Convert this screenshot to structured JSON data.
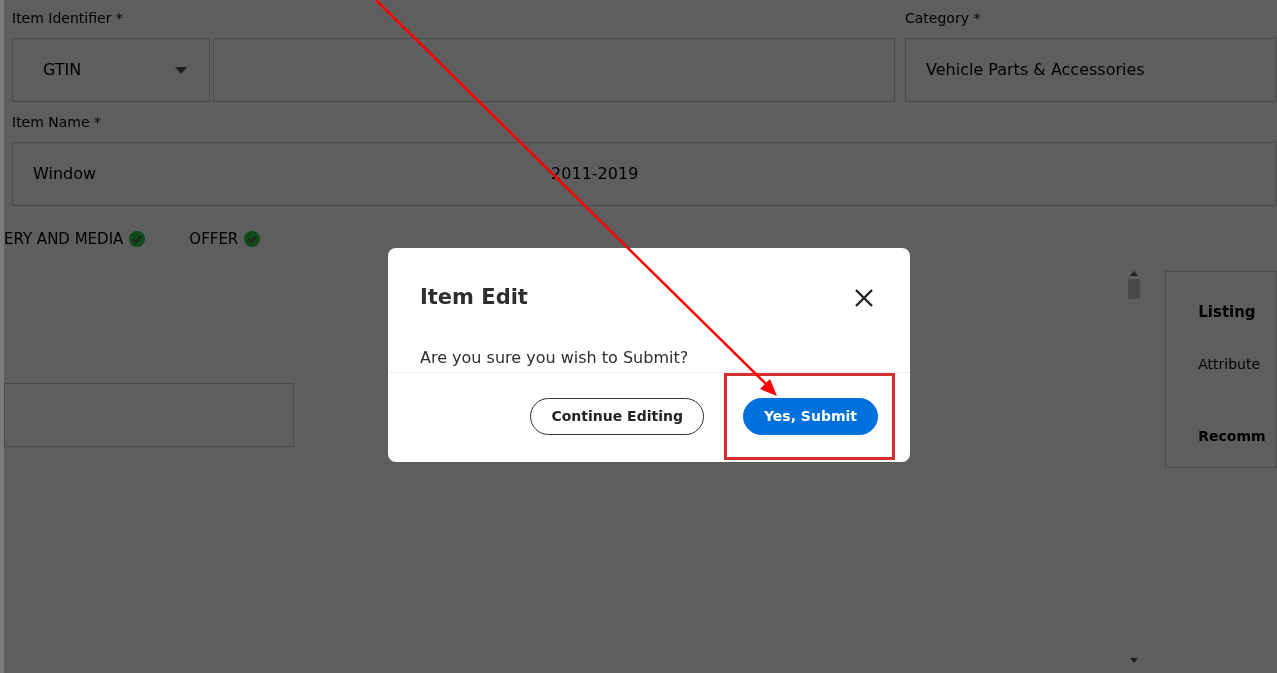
{
  "form": {
    "item_identifier": {
      "label": "Item Identifier *",
      "type_value": "GTIN"
    },
    "category": {
      "label": "Category *",
      "value": "Vehicle Parts & Accessories"
    },
    "item_name": {
      "label": "Item Name *",
      "value_start": "Window",
      "value_end": "2011-2019"
    }
  },
  "tabs": [
    {
      "label": "ERY AND MEDIA",
      "complete": true
    },
    {
      "label": "OFFER",
      "complete": true
    }
  ],
  "side_card": {
    "title": "Listing",
    "attribute_label": "Attribute",
    "heading": "Recomm"
  },
  "modal": {
    "title": "Item Edit",
    "message": "Are you sure you wish to Submit?",
    "buttons": [
      {
        "label": "Continue Editing",
        "kind": "secondary",
        "highlighted": false
      },
      {
        "label": "Yes, Submit",
        "kind": "primary",
        "highlighted": true
      }
    ]
  }
}
